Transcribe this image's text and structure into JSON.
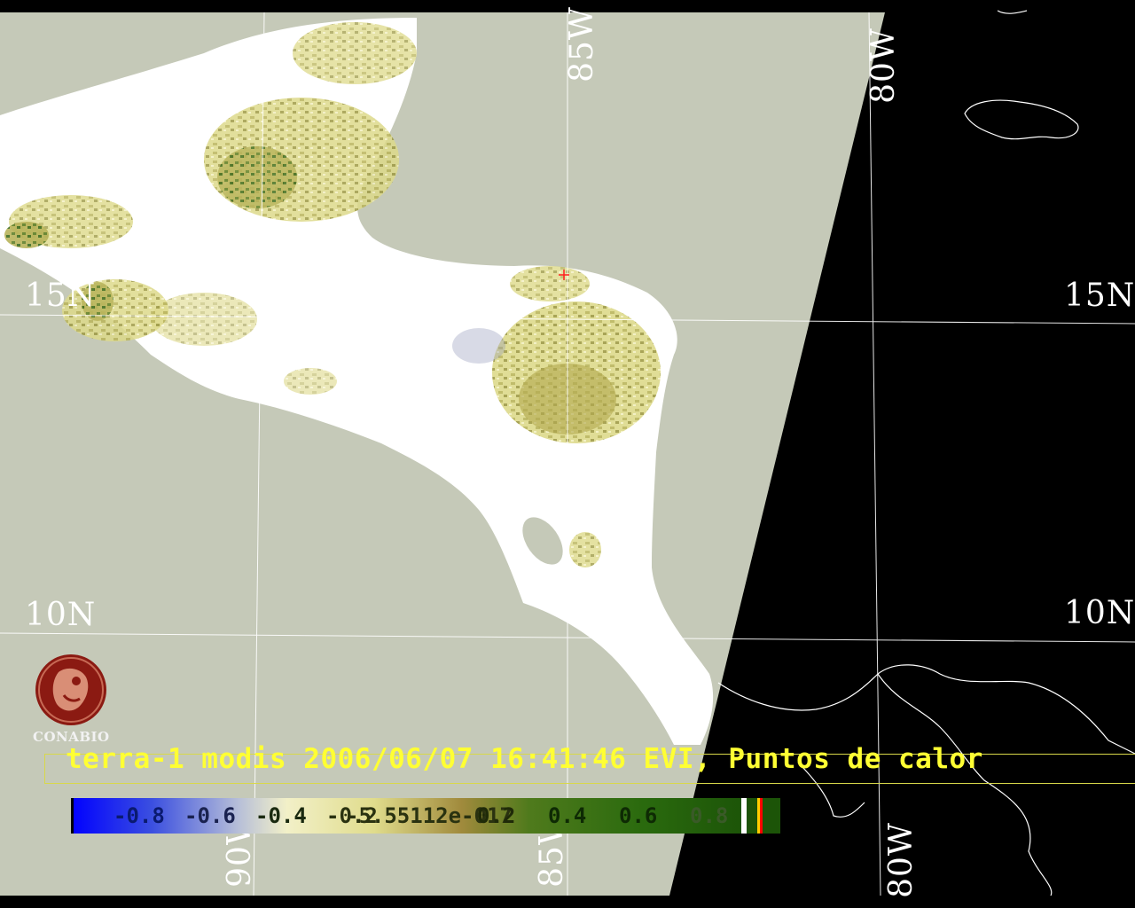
{
  "title": "terra-1 modis 2006/06/07 16:41:46 EVI, Puntos de calor",
  "grid_labels": {
    "lat_15_left": "15N",
    "lat_15_right": "15N",
    "lat_10_left": "10N",
    "lat_10_right": "10N",
    "lon_85_top": "85W",
    "lon_85_bottom": "85W",
    "lon_80_top": "80W",
    "lon_80_bottom": "80W",
    "lon_90_bottom": "90W"
  },
  "colorbar": {
    "ticks": [
      "-0.8",
      "-0.6",
      "-0.4",
      "-0.2",
      "-5.55112e-017",
      "0.2",
      "0.4",
      "0.6",
      "0.8"
    ],
    "range": [
      -1,
      1
    ]
  },
  "logo": {
    "name": "CONABIO"
  },
  "colors": {
    "ocean": "#c5c9b8",
    "land_cloud": "#ffffff",
    "vegetation_low": "#ddd98a",
    "vegetation_mid": "#a8a548",
    "vegetation_high": "#3d6b1e",
    "outside_swath": "#000000",
    "title": "#ffff33",
    "logo": "#8b1a12"
  }
}
